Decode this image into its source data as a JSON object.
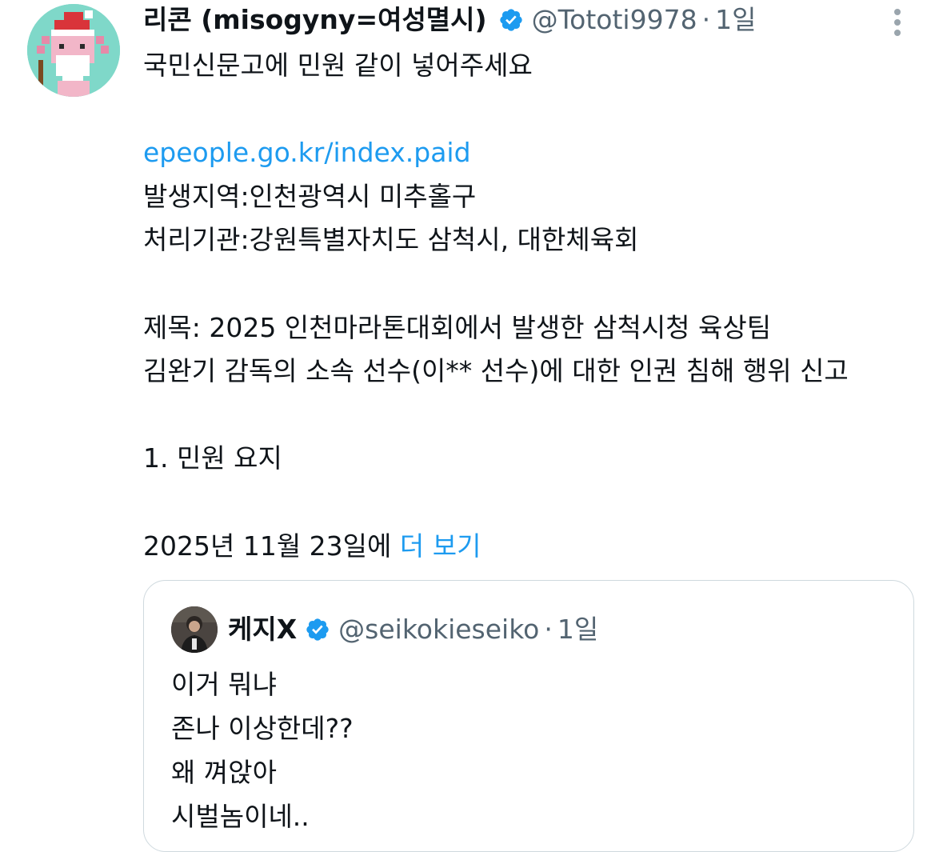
{
  "tweet": {
    "display_name": "리콘 (misogyny=여성멸시)",
    "handle": "@Tototi9978",
    "separator": "·",
    "time": "1일",
    "lines": [
      {
        "text": "국민신문고에 민원 같이 넣어주세요"
      },
      {
        "text": ""
      },
      {
        "text": "epeople.go.kr/index.paid",
        "link": true
      },
      {
        "text": "발생지역:인천광역시 미추홀구"
      },
      {
        "text": "처리기관:강원특별자치도 삼척시, 대한체육회"
      },
      {
        "text": ""
      },
      {
        "text": "제목: 2025 인천마라톤대회에서 발생한 삼척시청 육상팀"
      },
      {
        "text": "김완기 감독의 소속 선수(이** 선수)에 대한 인권 침해 행위 신고"
      },
      {
        "text": ""
      },
      {
        "text": "1. 민원 요지"
      },
      {
        "text": ""
      },
      {
        "text": "2025년 11월 23일에 ",
        "more": "더 보기"
      }
    ]
  },
  "quote": {
    "display_name": "케지X",
    "handle": "@seikokieseiko",
    "separator": "·",
    "time": "1일",
    "lines": [
      "이거 뭐냐",
      "존나 이상한데??",
      "왜 껴앉아",
      "시벌놈이네.."
    ]
  },
  "icons": {
    "avatar": "axolotl-santa-avatar",
    "quote_avatar": "person-photo-avatar",
    "verified": "verified-badge-icon",
    "more": "more-options-icon"
  },
  "colors": {
    "text": "#0f1419",
    "secondary": "#536471",
    "link": "#1d9bf0",
    "border": "#cfd9de"
  }
}
